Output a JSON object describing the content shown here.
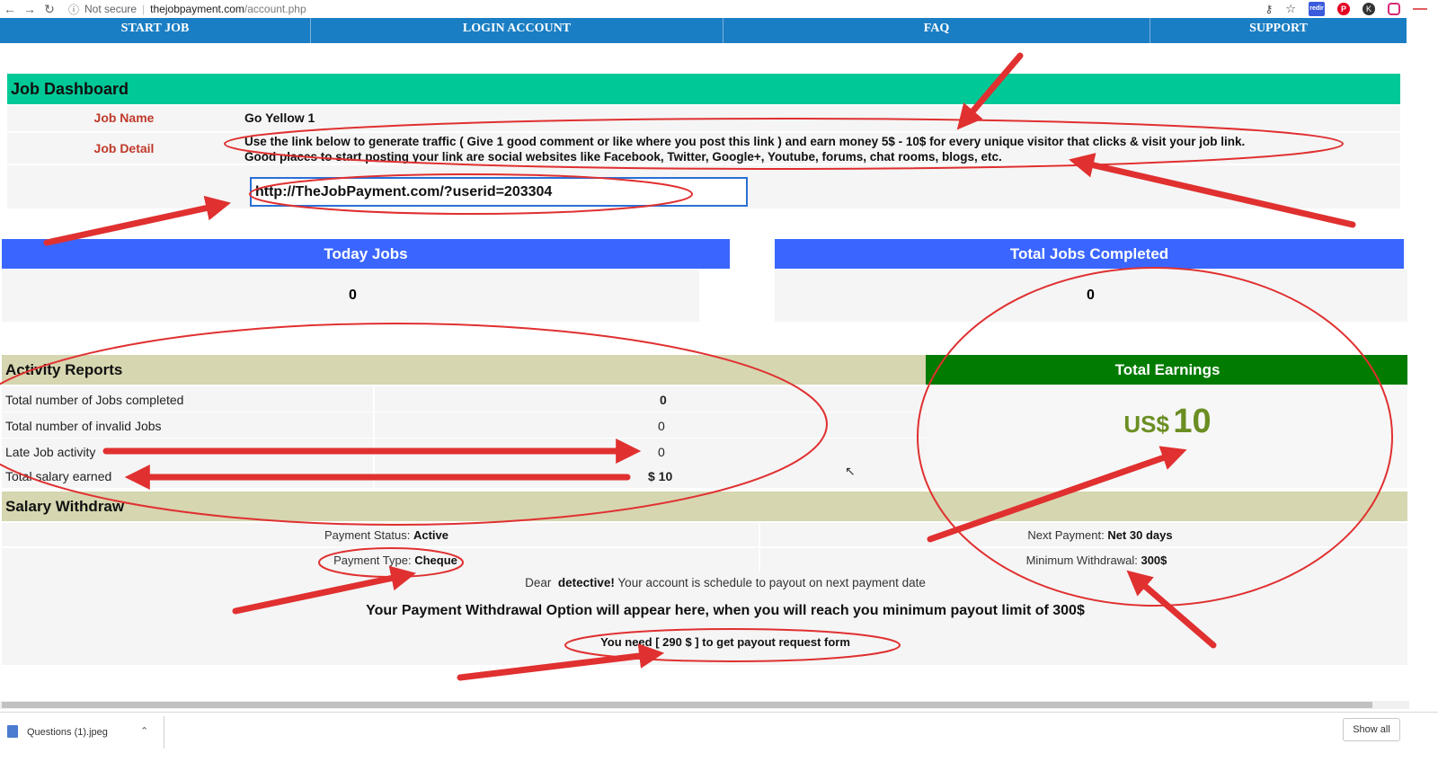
{
  "browser": {
    "secure_label": "Not secure",
    "url_host": "thejobpayment.com",
    "url_path": "/account.php",
    "ext_redir_label": "redir"
  },
  "nav": {
    "items": [
      "START JOB",
      "LOGIN ACCOUNT",
      "FAQ",
      "SUPPORT"
    ]
  },
  "dashboard": {
    "title": "Job Dashboard",
    "job_name_label": "Job Name",
    "job_name": "Go Yellow 1",
    "job_detail_label": "Job Detail",
    "job_detail_line1": "Use the link below to generate traffic ( Give 1 good comment or like where you post this link ) and earn money 5$ - 10$ for every unique visitor that clicks & visit your job link.",
    "job_detail_line2": "Good places to start posting your link are social websites like Facebook, Twitter, Google+, Youtube, forums, chat rooms, blogs, etc.",
    "job_link": "http://TheJobPayment.com/?userid=203304"
  },
  "stats": {
    "today_jobs_label": "Today Jobs",
    "today_jobs": "0",
    "total_completed_label": "Total Jobs Completed",
    "total_completed": "0"
  },
  "activity": {
    "title": "Activity Reports",
    "rows": [
      {
        "label": "Total number of Jobs completed",
        "value": "0"
      },
      {
        "label": "Total number of invalid Jobs",
        "value": "0"
      },
      {
        "label": "Late Job activity",
        "value": "0"
      },
      {
        "label": "Total salary earned",
        "value": "$ 10"
      }
    ]
  },
  "earnings": {
    "title": "Total Earnings",
    "currency": "US$",
    "amount": "10"
  },
  "withdraw": {
    "title": "Salary Withdraw",
    "payment_status_label": "Payment Status:",
    "payment_status": "Active",
    "payment_type_label": "Payment Type:",
    "payment_type": "Cheque",
    "next_payment_label": "Next Payment:",
    "next_payment": "Net 30 days",
    "min_withdrawal_label": "Minimum Withdrawal:",
    "min_withdrawal": "300$",
    "dear_prefix": "Dear",
    "username": "detective!",
    "dear_suffix": "Your account is schedule to payout on next payment date",
    "option_message": "Your Payment Withdrawal Option will appear here, when you will reach you minimum payout limit of 300$",
    "need_message": "You need [ 290 $ ] to get payout request form"
  },
  "downloads": {
    "file_name": "Questions (1).jpeg",
    "show_all": "Show all"
  },
  "colors": {
    "nav_bg": "#1a7ec4",
    "dashboard_header": "#00c896",
    "stat_header": "#3a66ff",
    "section_header": "#d6d6b0",
    "earnings_header": "#017b00",
    "earnings_value": "#6b8e23",
    "label_red": "#c0392b",
    "annotation_red": "#e03030"
  }
}
